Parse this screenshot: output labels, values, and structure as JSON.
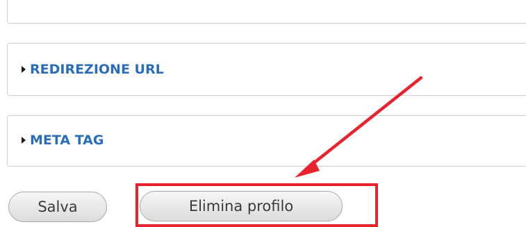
{
  "sections": {
    "redirect": {
      "label": "REDIREZIONE URL",
      "expanded": false
    },
    "meta": {
      "label": "META TAG",
      "expanded": false
    }
  },
  "buttons": {
    "save_label": "Salva",
    "delete_label": "Elimina profilo"
  },
  "annotation": {
    "color": "#e8232d",
    "target": "delete-profile-button"
  }
}
